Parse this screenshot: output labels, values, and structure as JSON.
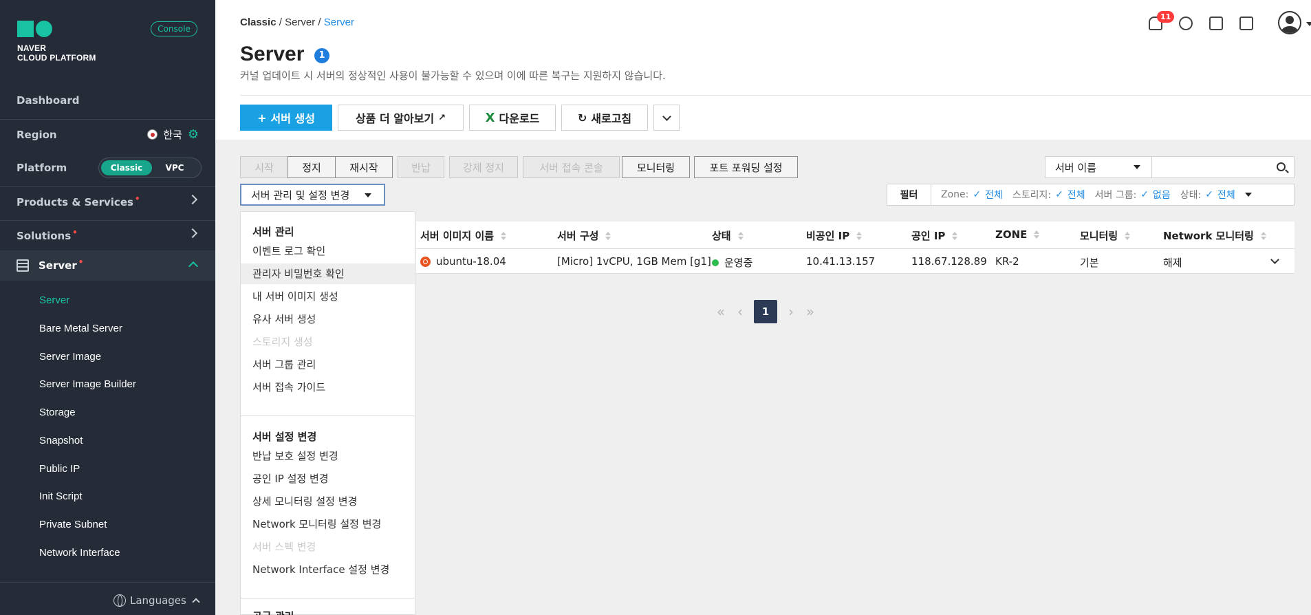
{
  "sidebar": {
    "logo_text_line1": "NAVER",
    "logo_text_line2": "CLOUD PLATFORM",
    "console_label": "Console",
    "dashboard": "Dashboard",
    "region_label": "Region",
    "region_value": "한국",
    "platform_label": "Platform",
    "platform_on": "Classic",
    "platform_off": "VPC",
    "products": "Products & Services",
    "solutions": "Solutions",
    "server": "Server",
    "required_mark": "•",
    "sub_items": [
      "Server",
      "Bare Metal Server",
      "Server Image",
      "Server Image Builder",
      "Storage",
      "Snapshot",
      "Public IP",
      "Init Script",
      "Private Subnet",
      "Network Interface"
    ],
    "languages": "Languages"
  },
  "header": {
    "breadcrumb": [
      "Classic",
      "Server",
      "Server"
    ],
    "breadcrumb_sep": "/",
    "title": "Server",
    "title_badge": "1",
    "subtitle": "커널 업데이트 시 서버의 정상적인 사용이 불가능할 수 있으며 이에 따른 복구는 지원하지 않습니다.",
    "notif_count": "11"
  },
  "toolbar": {
    "create": "서버 생성",
    "create_prefix": "+",
    "learn_more": "상품 더 알아보기",
    "download": "다운로드",
    "download_icon": "X",
    "refresh": "새로고침"
  },
  "actions": {
    "start": "시작",
    "stop": "정지",
    "restart": "재시작",
    "return": "반납",
    "force_stop": "강제 정지",
    "console": "서버 접속 콘솔",
    "monitoring": "모니터링",
    "port_forwarding": "포트 포워딩 설정",
    "manage_dropdown": "서버 관리 및 설정 변경"
  },
  "search": {
    "select_value": "서버 이름"
  },
  "filter": {
    "label": "필터",
    "items": [
      {
        "key": "Zone:",
        "value": "전체"
      },
      {
        "key": "스토리지:",
        "value": "전체"
      },
      {
        "key": "서버 그룹:",
        "value": "없음"
      },
      {
        "key": "상태:",
        "value": "전체"
      }
    ],
    "check": "✓"
  },
  "menu": {
    "section1": "서버 관리",
    "section1_items": [
      "이벤트 로그 확인",
      "관리자 비밀번호 확인",
      "내 서버 이미지 생성",
      "유사 서버 생성",
      "스토리지 생성",
      "서버 그룹 관리",
      "서버 접속 가이드"
    ],
    "section2": "서버 설정 변경",
    "section2_items": [
      "반납 보호 설정 변경",
      "공인 IP 설정 변경",
      "상세 모니터링 설정 변경",
      "Network 모니터링 설정 변경",
      "서버 스펙 변경",
      "Network Interface 설정 변경"
    ],
    "section3": "공급 관리"
  },
  "table": {
    "headers": [
      "서버 이미지 이름",
      "서버 구성",
      "상태",
      "비공인 IP",
      "공인 IP",
      "ZONE",
      "모니터링",
      "Network 모니터링"
    ],
    "rows": [
      {
        "image": "ubuntu-18.04",
        "config": "[Micro] 1vCPU, 1GB Mem [g1]",
        "status": "운영중",
        "private_ip": "10.41.13.157",
        "public_ip": "118.67.128.89",
        "zone": "KR-2",
        "monitoring": "기본",
        "network_monitoring": "해제"
      }
    ]
  },
  "pagination": {
    "first": "«",
    "prev": "‹",
    "current": "1",
    "next": "›",
    "last": "»"
  },
  "colors": {
    "sidebar_bg": "#252c37",
    "accent_green": "#17c3a3",
    "primary_blue": "#1aa1e3",
    "link_blue": "#1f8ce6",
    "pager_active": "#2d3a55"
  }
}
